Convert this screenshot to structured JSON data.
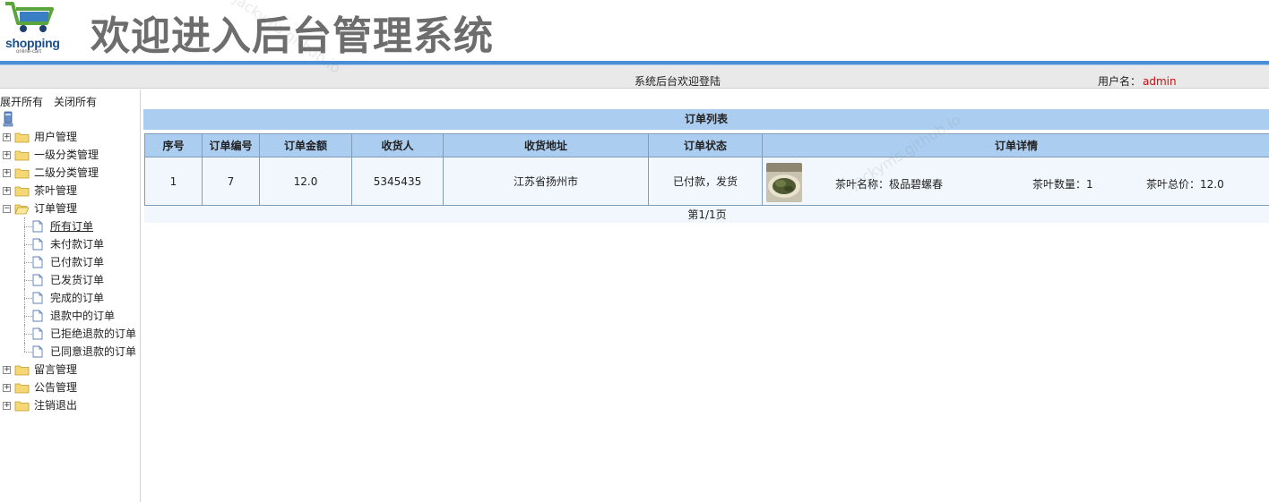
{
  "header": {
    "logo_text": "shopping",
    "logo_sub": "online-cart",
    "title": "欢迎进入后台管理系统"
  },
  "statusbar": {
    "welcome": "系统后台欢迎登陆",
    "user_label": "用户名：",
    "username": "admin"
  },
  "sidebar": {
    "expand_all": "展开所有",
    "collapse_all": "关闭所有",
    "nodes": [
      {
        "label": "用户管理"
      },
      {
        "label": "一级分类管理"
      },
      {
        "label": "二级分类管理"
      },
      {
        "label": "茶叶管理"
      },
      {
        "label": "订单管理"
      }
    ],
    "order_children": [
      {
        "label": "所有订单"
      },
      {
        "label": "未付款订单"
      },
      {
        "label": "已付款订单"
      },
      {
        "label": "已发货订单"
      },
      {
        "label": "完成的订单"
      },
      {
        "label": "退款中的订单"
      },
      {
        "label": "已拒绝退款的订单"
      },
      {
        "label": "已同意退款的订单"
      }
    ],
    "nodes_after": [
      {
        "label": "留言管理"
      },
      {
        "label": "公告管理"
      },
      {
        "label": "注销退出"
      }
    ]
  },
  "main": {
    "list_title": "订单列表",
    "columns": [
      "序号",
      "订单编号",
      "订单金额",
      "收货人",
      "收货地址",
      "订单状态",
      "订单详情"
    ],
    "rows": [
      {
        "index": "1",
        "order_no": "7",
        "amount": "12.0",
        "receiver": "5345435",
        "address": "江苏省扬州市",
        "status": "已付款，发货",
        "detail_name": "茶叶名称：极品碧螺春",
        "detail_qty": "茶叶数量：1",
        "detail_total": "茶叶总价：12.0"
      }
    ],
    "pager": "第1/1页"
  },
  "watermark": "jackyms.github.io",
  "colors": {
    "header_blue": "#4a8ed6",
    "table_header": "#abcdf0",
    "row_bg": "#f1f7fd",
    "username": "#c81010"
  }
}
